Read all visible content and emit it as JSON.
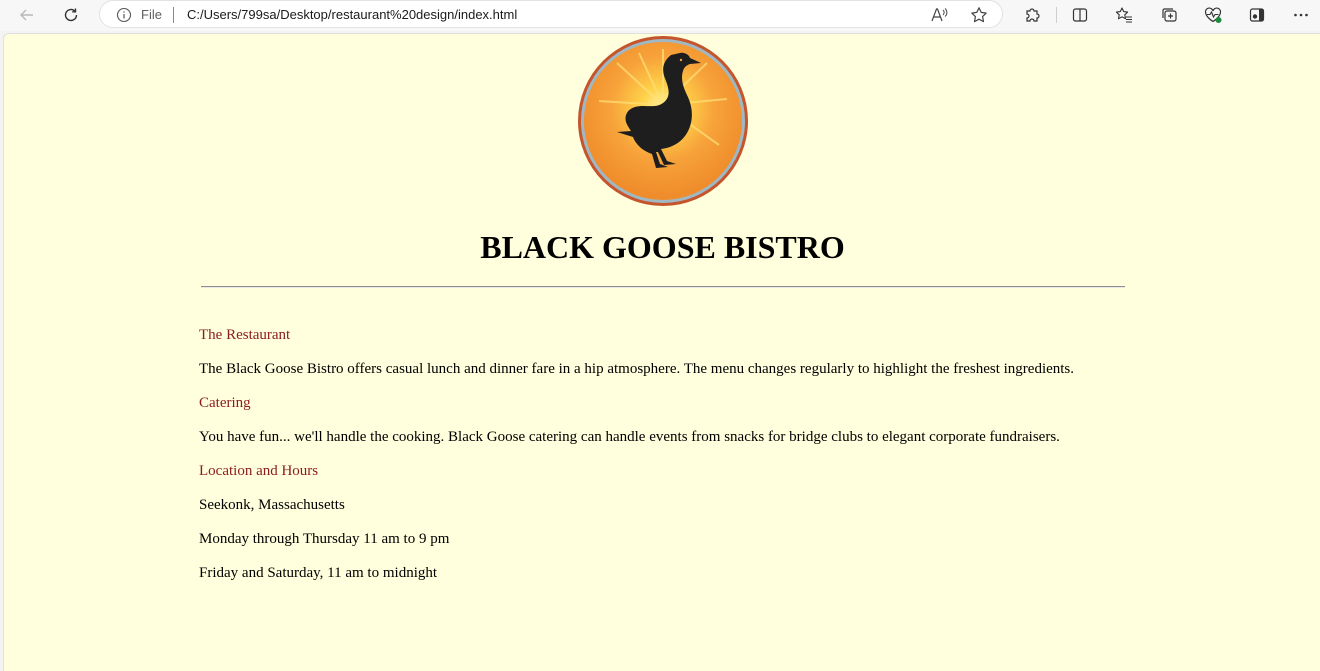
{
  "browser": {
    "address_scheme": "File",
    "url": "C:/Users/799sa/Desktop/restaurant%20design/index.html",
    "icons": {
      "back": "back-arrow-icon",
      "reload": "reload-icon",
      "info": "info-icon",
      "read_aloud": "read-aloud-icon",
      "favorite": "star-icon",
      "extensions": "puzzle-icon",
      "split_screen": "split-screen-icon",
      "favorites": "favorites-icon",
      "collections": "collections-icon",
      "performance": "heartbeat-icon",
      "sidebar": "sidebar-icon",
      "more": "more-icon"
    }
  },
  "page": {
    "background": "#ffffdd",
    "logo_icon": "goose-logo",
    "title": "BLACK GOOSE BISTRO",
    "heading_color": "#8b1c1c",
    "sections": [
      {
        "heading": "The Restaurant",
        "paragraphs": [
          "The Black Goose Bistro offers casual lunch and dinner fare in a hip atmosphere. The menu changes regularly to highlight the freshest ingredients."
        ]
      },
      {
        "heading": "Catering",
        "paragraphs": [
          "You have fun... we'll handle the cooking. Black Goose catering can handle events from snacks for bridge clubs to elegant corporate fundraisers."
        ]
      },
      {
        "heading": "Location and Hours",
        "paragraphs": [
          "Seekonk, Massachusetts",
          "Monday through Thursday 11 am to 9 pm",
          "Friday and Saturday, 11 am to midnight"
        ]
      }
    ]
  }
}
